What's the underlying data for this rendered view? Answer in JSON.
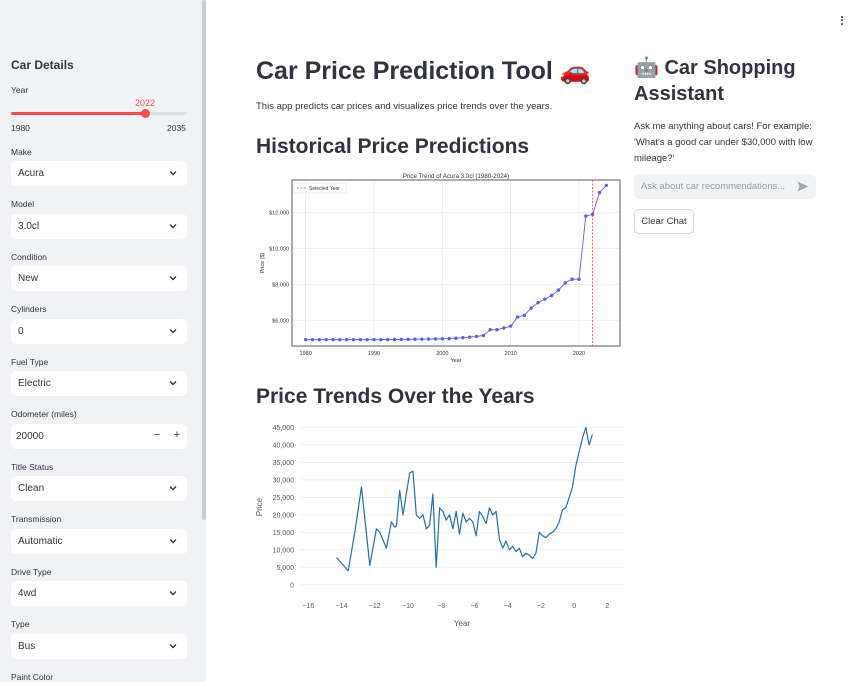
{
  "sidebar": {
    "title": "Car Details",
    "year": {
      "label": "Year",
      "value": "2022",
      "min": "1980",
      "max": "2035",
      "fraction": 0.764
    },
    "make": {
      "label": "Make",
      "value": "Acura"
    },
    "model": {
      "label": "Model",
      "value": "3.0cl"
    },
    "condition": {
      "label": "Condition",
      "value": "New"
    },
    "cylinders": {
      "label": "Cylinders",
      "value": "0"
    },
    "fuel": {
      "label": "Fuel Type",
      "value": "Electric"
    },
    "odometer": {
      "label": "Odometer (miles)",
      "value": "20000",
      "minus": "−",
      "plus": "+"
    },
    "title_status": {
      "label": "Title Status",
      "value": "Clean"
    },
    "transmission": {
      "label": "Transmission",
      "value": "Automatic"
    },
    "drive": {
      "label": "Drive Type",
      "value": "4wd"
    },
    "type": {
      "label": "Type",
      "value": "Bus"
    },
    "paint": {
      "label": "Paint Color"
    }
  },
  "main": {
    "title": "Car Price Prediction Tool 🚗",
    "description": "This app predicts car prices and visualizes price trends over the years.",
    "section1": "Historical Price Predictions",
    "section2": "Price Trends Over the Years"
  },
  "assistant": {
    "title": "🤖 Car Shopping Assistant",
    "description": "Ask me anything about cars! For example: 'What's a good car under $30,000 with low mileage?'",
    "placeholder": "Ask about car recommendations...",
    "clear_label": "Clear Chat"
  },
  "colors": {
    "accent": "#ff4b4b",
    "line1": "#5b5bf5",
    "line2": "#1f6fb5"
  },
  "chart_data": [
    {
      "type": "line",
      "title": "Price Trend of Acura 3.0cl (1980-2024)",
      "xlabel": "Year",
      "ylabel": "Price ($)",
      "xlim": [
        1978,
        2026
      ],
      "ylim": [
        4600,
        13800
      ],
      "xticks": [
        1980,
        1990,
        2000,
        2010,
        2020
      ],
      "yticks": [
        6000,
        8000,
        10000,
        12000
      ],
      "ytick_labels": [
        "$6,000",
        "$8,000",
        "$10,000",
        "$12,000"
      ],
      "legend": "top-left",
      "legend_label": "Selected Year",
      "selected_year": 2022,
      "x": [
        1980,
        1981,
        1982,
        1983,
        1984,
        1985,
        1986,
        1987,
        1988,
        1989,
        1990,
        1991,
        1992,
        1993,
        1994,
        1995,
        1996,
        1997,
        1998,
        1999,
        2000,
        2001,
        2002,
        2003,
        2004,
        2005,
        2006,
        2007,
        2008,
        2009,
        2010,
        2011,
        2012,
        2013,
        2014,
        2015,
        2016,
        2017,
        2018,
        2019,
        2020,
        2021,
        2022,
        2023,
        2024
      ],
      "y": [
        4950,
        4950,
        4950,
        4950,
        4950,
        4950,
        4950,
        4950,
        4950,
        4950,
        4950,
        4950,
        4955,
        4960,
        4965,
        4970,
        4975,
        4980,
        4985,
        4990,
        5000,
        5010,
        5030,
        5060,
        5090,
        5130,
        5180,
        5500,
        5500,
        5600,
        5700,
        6200,
        6300,
        6700,
        7000,
        7200,
        7400,
        7700,
        8100,
        8300,
        8300,
        11800,
        11900,
        13100,
        13500
      ]
    },
    {
      "type": "line",
      "xlabel": "Year",
      "ylabel": "Price",
      "xlim": [
        -16.5,
        3
      ],
      "ylim": [
        -1500,
        46000
      ],
      "xticks": [
        -16,
        -14,
        -12,
        -10,
        -8,
        -6,
        -4,
        -2,
        0,
        2
      ],
      "xtick_labels": [
        "−16",
        "−14",
        "−12",
        "−10",
        "−8",
        "−6",
        "−4",
        "−2",
        "0",
        "2"
      ],
      "yticks": [
        0,
        5000,
        10000,
        15000,
        20000,
        25000,
        30000,
        35000,
        40000,
        45000
      ],
      "ytick_labels": [
        "0",
        "5,000",
        "10,000",
        "15,000",
        "20,000",
        "25,000",
        "30,000",
        "35,000",
        "40,000",
        "45,000"
      ],
      "x": [
        -14.3,
        -13.6,
        -13.2,
        -12.8,
        -12.3,
        -11.9,
        -11.7,
        -11.3,
        -11.0,
        -10.8,
        -10.7,
        -10.5,
        -10.3,
        -10.1,
        -9.9,
        -9.7,
        -9.5,
        -9.3,
        -9.1,
        -8.9,
        -8.7,
        -8.5,
        -8.3,
        -8.1,
        -7.9,
        -7.7,
        -7.5,
        -7.3,
        -7.1,
        -6.9,
        -6.7,
        -6.5,
        -6.3,
        -6.1,
        -5.9,
        -5.7,
        -5.5,
        -5.3,
        -5.1,
        -4.9,
        -4.7,
        -4.5,
        -4.3,
        -4.1,
        -3.9,
        -3.7,
        -3.5,
        -3.3,
        -3.1,
        -2.9,
        -2.7,
        -2.5,
        -2.3,
        -2.1,
        -1.9,
        -1.7,
        -1.5,
        -1.3,
        -1.1,
        -0.9,
        -0.7,
        -0.5,
        -0.3,
        -0.1,
        0.1,
        0.3,
        0.5,
        0.7,
        0.9,
        1.1,
        1.3,
        1.5,
        1.7
      ],
      "y": [
        7800,
        4000,
        15000,
        28000,
        5500,
        16000,
        15000,
        10500,
        18000,
        16500,
        16800,
        27000,
        20000,
        26000,
        32000,
        32500,
        20000,
        19000,
        20000,
        16000,
        17000,
        26000,
        5000,
        22000,
        21000,
        18500,
        20000,
        16000,
        21000,
        14500,
        20500,
        18000,
        19000,
        18000,
        14000,
        21000,
        19500,
        17500,
        22000,
        20000,
        21000,
        13000,
        10500,
        12500,
        10000,
        11000,
        9500,
        10500,
        8000,
        9000,
        8500,
        7500,
        9000,
        15000,
        14000,
        13500,
        14500,
        15000,
        16000,
        18000,
        21500,
        22000,
        25000,
        28000,
        34000,
        38000,
        42000,
        45000,
        40000,
        43000
      ]
    }
  ]
}
